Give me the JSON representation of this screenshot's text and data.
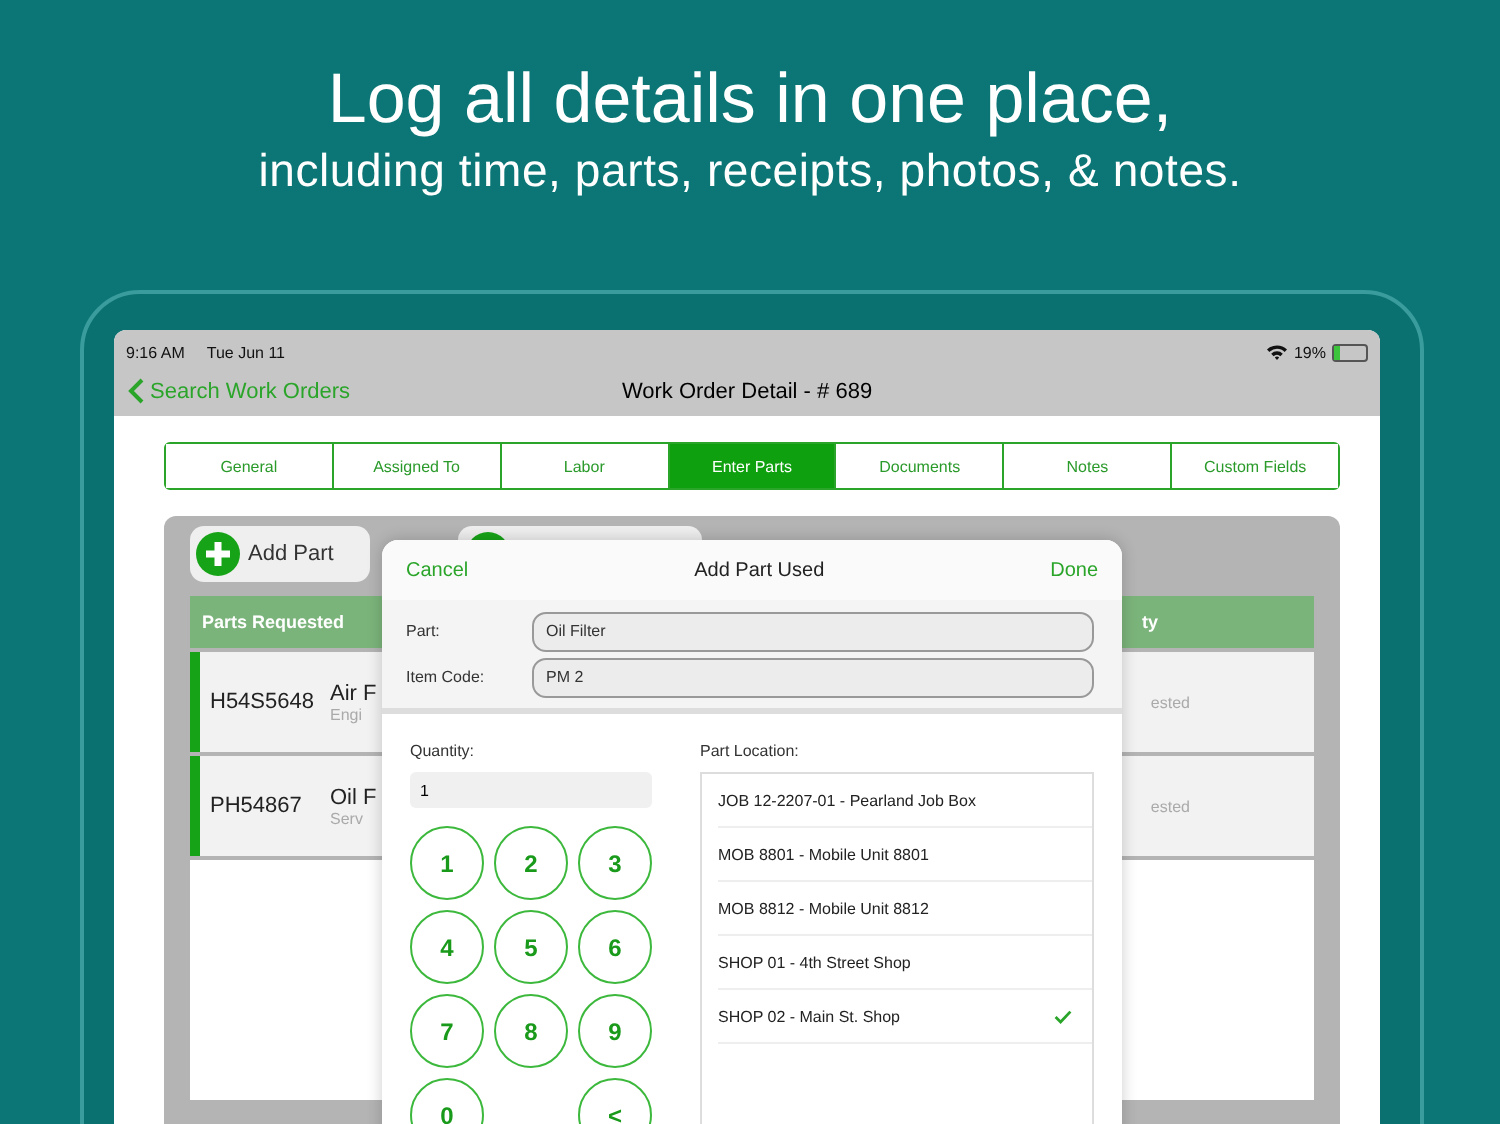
{
  "headline": {
    "title": "Log all details in one place,",
    "subtitle": "including time, parts, receipts, photos, & notes."
  },
  "status_bar": {
    "time": "9:16 AM",
    "date": "Tue Jun 11",
    "battery": "19%"
  },
  "nav": {
    "back": "Search Work Orders",
    "title": "Work Order Detail - # 689"
  },
  "tabs": [
    {
      "label": "General",
      "selected": false
    },
    {
      "label": "Assigned To",
      "selected": false
    },
    {
      "label": "Labor",
      "selected": false
    },
    {
      "label": "Enter Parts",
      "selected": true
    },
    {
      "label": "Documents",
      "selected": false
    },
    {
      "label": "Notes",
      "selected": false
    },
    {
      "label": "Custom Fields",
      "selected": false
    }
  ],
  "add_part_button": "Add Part",
  "table": {
    "header_left": "Parts Requested",
    "header_right": "ty",
    "rows": [
      {
        "code": "H54S5648",
        "name": "Air F",
        "category": "Engi",
        "status": "ested"
      },
      {
        "code": "PH54867",
        "name": "Oil F",
        "category": "Serv",
        "status": "ested"
      }
    ]
  },
  "dialog": {
    "cancel": "Cancel",
    "title": "Add Part Used",
    "done": "Done",
    "fields": [
      {
        "label": "Part:",
        "value": "Oil Filter"
      },
      {
        "label": "Item Code:",
        "value": "PM 2"
      }
    ],
    "quantity_label": "Quantity:",
    "quantity": "1",
    "keys": [
      "1",
      "2",
      "3",
      "4",
      "5",
      "6",
      "7",
      "8",
      "9",
      "0",
      "<"
    ],
    "location_label": "Part Location:",
    "locations": [
      {
        "label": "JOB 12-2207-01 - Pearland Job  Box",
        "selected": false
      },
      {
        "label": "MOB 8801 - Mobile Unit 8801",
        "selected": false
      },
      {
        "label": "MOB 8812 - Mobile Unit 8812",
        "selected": false
      },
      {
        "label": "SHOP 01 - 4th Street Shop",
        "selected": false
      },
      {
        "label": "SHOP 02 - Main St. Shop",
        "selected": true
      }
    ]
  }
}
